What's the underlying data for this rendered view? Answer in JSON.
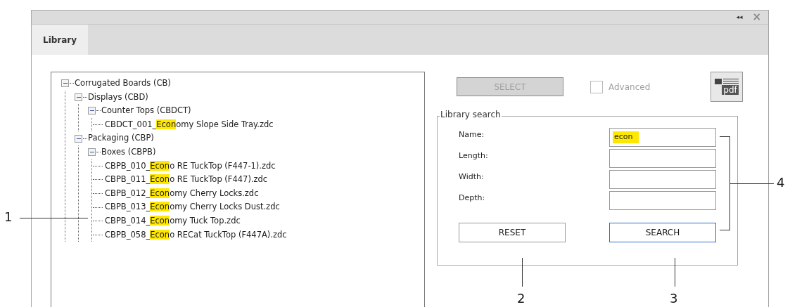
{
  "window": {
    "buttons": [
      "◂◂",
      "×"
    ]
  },
  "tabs": [
    {
      "label": "Library",
      "selected": true
    }
  ],
  "tree": [
    {
      "label": "Corrugated Boards (CB)",
      "expanded": true,
      "children": [
        {
          "label": "Displays (CBD)",
          "expanded": true,
          "children": [
            {
              "label": "Counter Tops (CBDCT)",
              "expanded": true,
              "children": [
                {
                  "prefix": "CBDCT_001_",
                  "match": "Econ",
                  "suffix": "omy Slope Side Tray.zdc"
                }
              ]
            }
          ]
        },
        {
          "label": "Packaging (CBP)",
          "expanded": true,
          "children": [
            {
              "label": "Boxes (CBPB)",
              "expanded": true,
              "children": [
                {
                  "prefix": "CBPB_010_",
                  "match": "Econ",
                  "suffix": "o RE TuckTop (F447-1).zdc"
                },
                {
                  "prefix": "CBPB_011_",
                  "match": "Econ",
                  "suffix": "o RE TuckTop (F447).zdc"
                },
                {
                  "prefix": "CBPB_012_",
                  "match": "Econ",
                  "suffix": "omy Cherry Locks.zdc"
                },
                {
                  "prefix": "CBPB_013_",
                  "match": "Econ",
                  "suffix": "omy Cherry Locks Dust.zdc"
                },
                {
                  "prefix": "CBPB_014_",
                  "match": "Econ",
                  "suffix": "omy Tuck Top.zdc"
                },
                {
                  "prefix": "CBPB_058_",
                  "match": "Econ",
                  "suffix": "o RECat TuckTop (F447A).zdc"
                }
              ]
            }
          ]
        }
      ]
    }
  ],
  "select_button": {
    "label": "SELECT",
    "disabled": true
  },
  "advanced": {
    "label": "Advanced",
    "checked": false,
    "disabled": true
  },
  "pdf_button": {
    "label": "pdf"
  },
  "search": {
    "title": "Library search",
    "fields": [
      {
        "label": "Name:",
        "value": "econ",
        "highlighted": true
      },
      {
        "label": "Length:"
      },
      {
        "label": "Width:"
      },
      {
        "label": "Depth:"
      }
    ],
    "buttons": [
      {
        "label": "RESET",
        "focused": false
      },
      {
        "label": "SEARCH",
        "focused": true
      }
    ]
  },
  "callouts": [
    "1",
    "2",
    "3",
    "4"
  ]
}
